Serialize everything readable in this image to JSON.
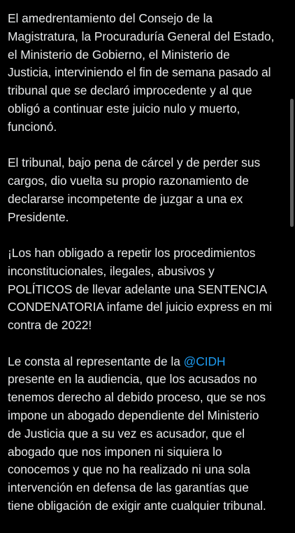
{
  "post": {
    "paragraphs": [
      "El amedrentamiento del Consejo de la\nMagistratura, la Procuraduría General del Estado,\nel Ministerio de Gobierno, el Ministerio de\nJusticia, interviniendo el fin de semana pasado al\ntribunal que se declaró improcedente y al que\nobligó a continuar este juicio nulo y muerto,\nfuncionó.",
      "El tribunal, bajo pena de cárcel y de perder sus\ncargos, dio vuelta su propio razonamiento de\ndeclararse incompetente de juzgar a una ex\nPresidente.",
      "¡Los han obligado a repetir los procedimientos\ninconstitucionales, ilegales, abusivos y\nPOLÍTICOS de llevar adelante una SENTENCIA\nCONDENATORIA infame del juicio express en mi\ncontra de 2022!"
    ],
    "last_paragraph": {
      "before_mention": "Le consta al representante de la ",
      "mention": "@CIDH",
      "after_mention": "\npresente en la audiencia, que los acusados no\ntenemos derecho al debido proceso, que se nos\nimpone un abogado dependiente del Ministerio\nde Justicia que a su vez es acusador, que el\nabogado que nos imponen ni siquiera lo\nconocemos y que no ha realizado ni una sola\nintervención en defensa de las garantías que\ntiene obligación de exigir ante  cualquier tribunal."
    }
  },
  "colors": {
    "background": "#000000",
    "text": "#e7e9ea",
    "link": "#1d9bf0",
    "scrollbar": "#5c5c5c"
  }
}
